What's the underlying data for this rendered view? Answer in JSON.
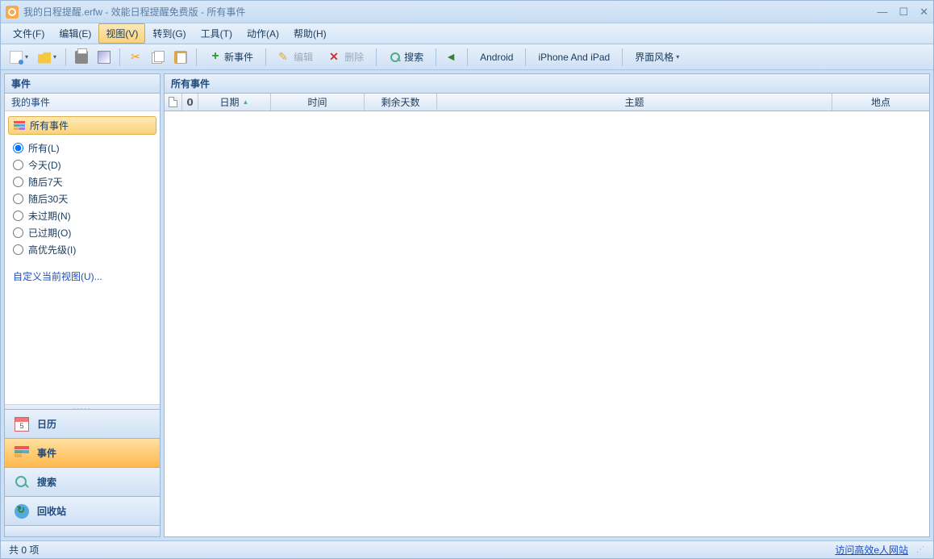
{
  "titlebar": {
    "title": "我的日程提醒.erfw - 效能日程提醒免费版 - 所有事件"
  },
  "menubar": {
    "file": "文件(F)",
    "edit": "编辑(E)",
    "view": "视图(V)",
    "goto": "转到(G)",
    "tools": "工具(T)",
    "action": "动作(A)",
    "help": "帮助(H)"
  },
  "toolbar": {
    "new_event": "新事件",
    "edit": "编辑",
    "delete": "删除",
    "search": "搜索",
    "android": "Android",
    "iphone": "iPhone And iPad",
    "skin": "界面风格"
  },
  "sidebar": {
    "events_header": "事件",
    "my_events": "我的事件",
    "all_events": "所有事件",
    "filters": {
      "all": "所有(L)",
      "today": "今天(D)",
      "next7": "随后7天",
      "next30": "随后30天",
      "not_overdue": "未过期(N)",
      "overdue": "已过期(O)",
      "high_priority": "高优先级(I)"
    },
    "customize": "自定义当前视图(U)...",
    "nav": {
      "calendar": "日历",
      "events": "事件",
      "search": "搜索",
      "recycle": "回收站"
    }
  },
  "main": {
    "header": "所有事件",
    "columns": {
      "date": "日期",
      "time": "时间",
      "days_left": "剩余天数",
      "subject": "主题",
      "place": "地点"
    }
  },
  "statusbar": {
    "count": "共 0 项",
    "link": "访问高效e人网站"
  }
}
